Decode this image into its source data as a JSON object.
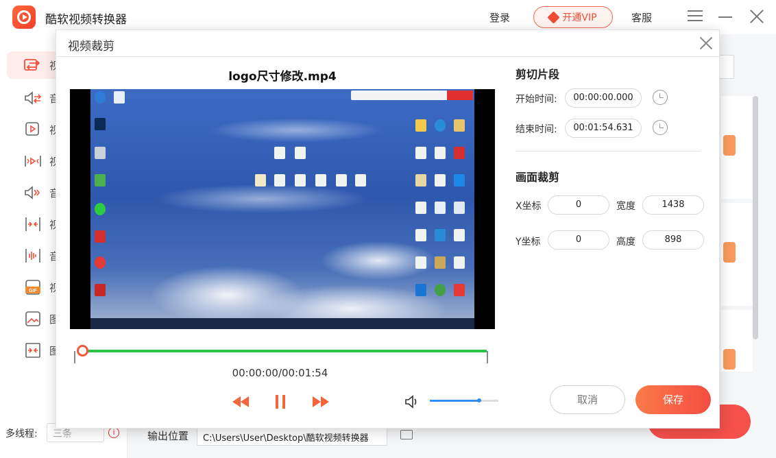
{
  "app": {
    "title": "酷软视频转换器",
    "login": "登录",
    "vip": "开通VIP",
    "service": "客服"
  },
  "sidebar": {
    "items": [
      {
        "label": "视",
        "icon": "video-convert-icon"
      },
      {
        "label": "音",
        "icon": "audio-convert-icon"
      },
      {
        "label": "视",
        "icon": "video-edit-icon"
      },
      {
        "label": "视",
        "icon": "video-compress-icon"
      },
      {
        "label": "音",
        "icon": "audio-edit-icon"
      },
      {
        "label": "视",
        "icon": "video-merge-icon"
      },
      {
        "label": "音",
        "icon": "audio-merge-icon"
      },
      {
        "label": "视",
        "icon": "gif-icon"
      },
      {
        "label": "图",
        "icon": "image-icon"
      },
      {
        "label": "图",
        "icon": "image-compress-icon"
      }
    ],
    "threads_label": "多线程:",
    "threads_value": "三条"
  },
  "footer": {
    "output_label": "输出位置",
    "output_path": "C:\\Users\\User\\Desktop\\酷软视频转换器"
  },
  "dialog": {
    "title": "视频裁剪",
    "file_name": "logo尺寸修改.mp4",
    "time_display": "00:00:00/00:01:54",
    "playback_progress": 0,
    "volume_level": 0.72,
    "clip_section": {
      "title": "剪切片段",
      "start_label": "开始时间:",
      "start_value": "00:00:00.000",
      "end_label": "结束时间:",
      "end_value": "00:01:54.631"
    },
    "crop_section": {
      "title": "画面裁剪",
      "x_label": "X坐标",
      "x_value": "0",
      "width_label": "宽度",
      "width_value": "1438",
      "y_label": "Y坐标",
      "y_value": "0",
      "height_label": "高度",
      "height_value": "898"
    },
    "cancel": "取消",
    "save": "保存"
  },
  "colors": {
    "accent": "#f4503f",
    "track": "#2ec24a",
    "volume": "#2f8cf0"
  }
}
